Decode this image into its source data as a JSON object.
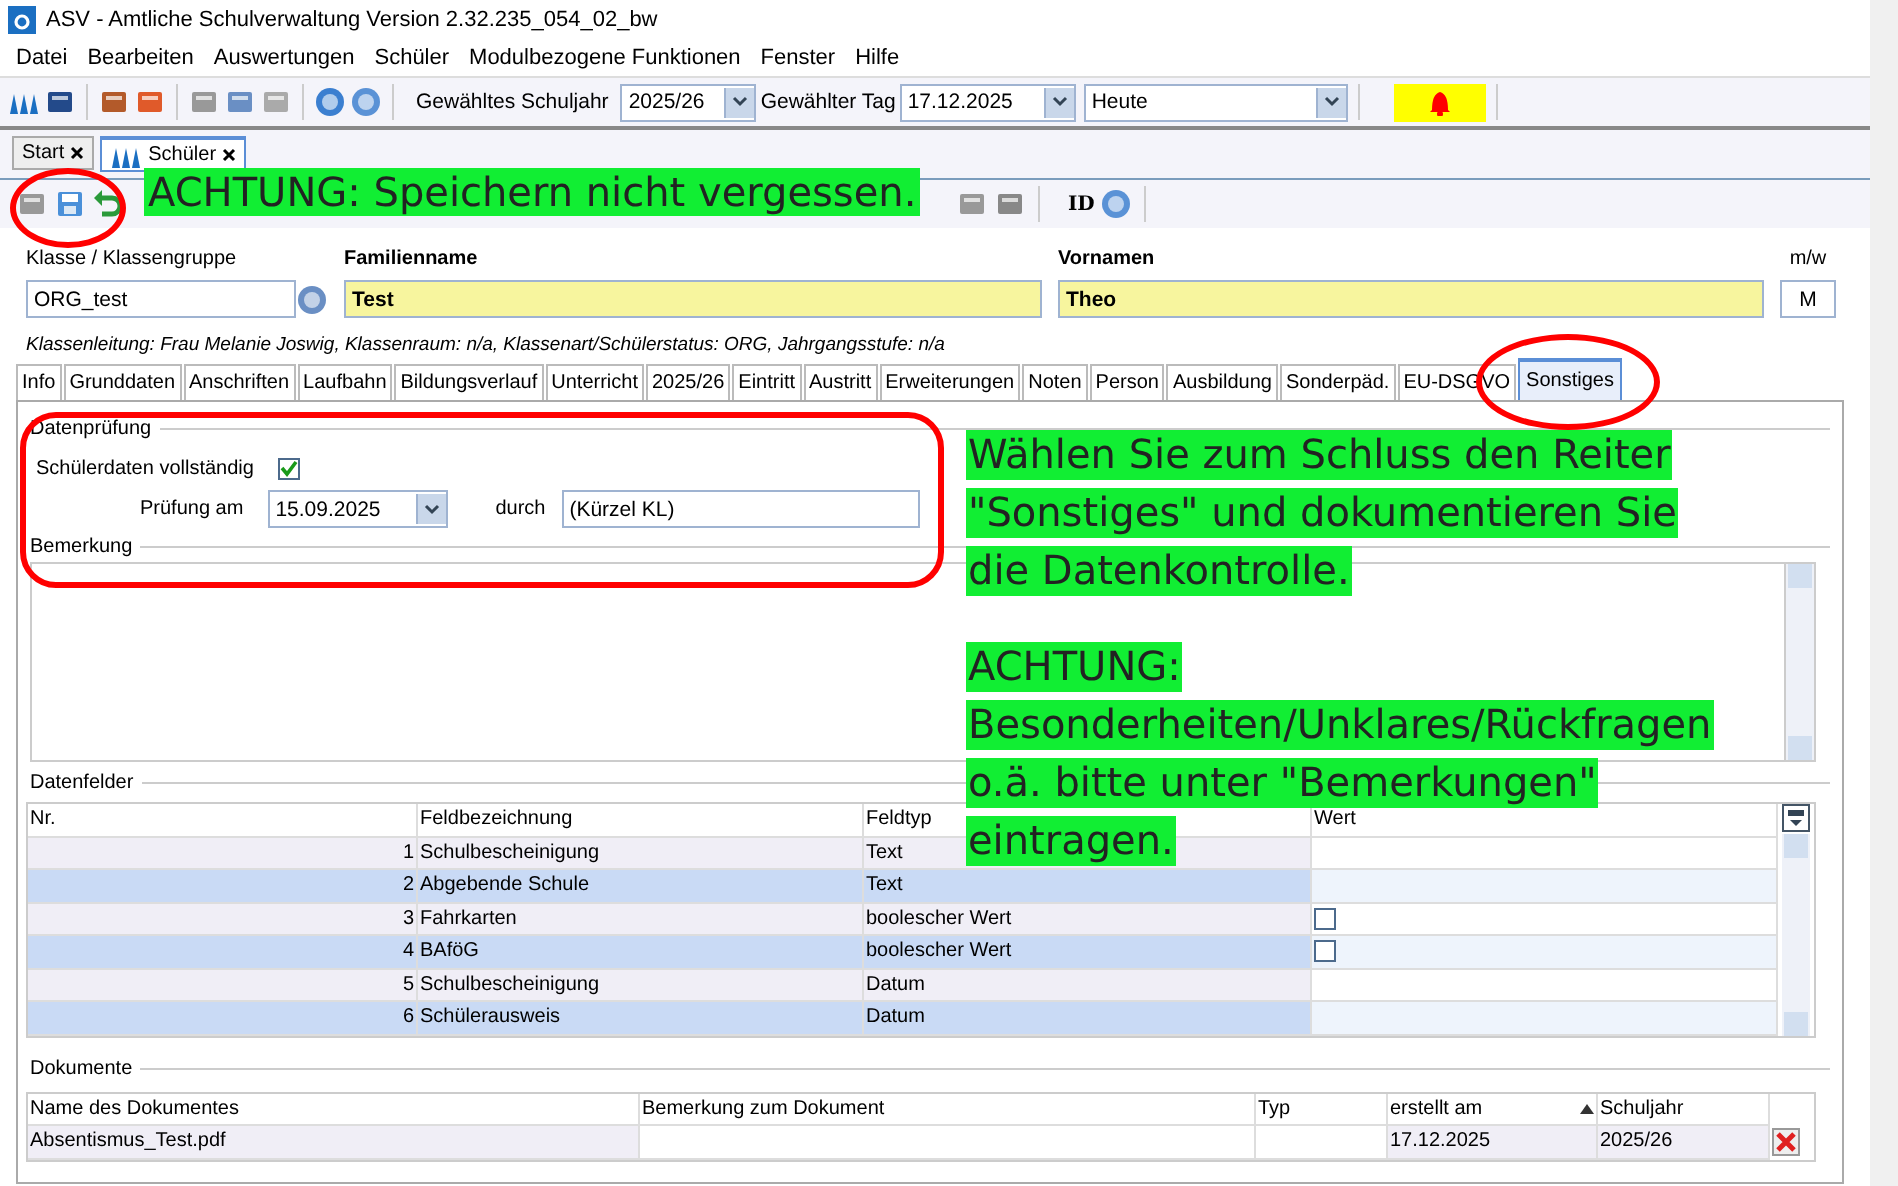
{
  "window": {
    "title": "ASV - Amtliche Schulverwaltung Version 2.32.235_054_02_bw"
  },
  "menu": [
    {
      "label": "Datei"
    },
    {
      "label": "Bearbeiten"
    },
    {
      "label": "Auswertungen"
    },
    {
      "label": "Schüler"
    },
    {
      "label": "Modulbezogene Funktionen"
    },
    {
      "label": "Fenster"
    },
    {
      "label": "Hilfe"
    }
  ],
  "toolbar": {
    "schuljahr_label": "Gewähltes Schuljahr",
    "schuljahr": "2025/26",
    "tag_label": "Gewählter Tag",
    "tag": "17.12.2025",
    "tag_mode": "Heute"
  },
  "doc_tabs": [
    {
      "label": "Start",
      "selected": false
    },
    {
      "label": "Schüler",
      "selected": true
    }
  ],
  "toolbar2": {
    "id_label": "ID"
  },
  "callout_top": "ACHTUNG: Speichern nicht vergessen.",
  "student": {
    "klasse_label": "Klasse / Klassengruppe",
    "klasse": "ORG_test",
    "familienname_label": "Familienname",
    "familienname": "Test",
    "vornamen_label": "Vornamen",
    "vornamen": "Theo",
    "gender_label": "m/w",
    "gender": "M",
    "info": "Klassenleitung: Frau Melanie Joswig, Klassenraum: n/a, Klassenart/Schülerstatus: ORG, Jahrgangsstufe: n/a"
  },
  "tabs": [
    {
      "label": "Info",
      "selected": false
    },
    {
      "label": "Grunddaten",
      "selected": false
    },
    {
      "label": "Anschriften",
      "selected": false
    },
    {
      "label": "Laufbahn",
      "selected": false
    },
    {
      "label": "Bildungsverlauf",
      "selected": false
    },
    {
      "label": "Unterricht",
      "selected": false
    },
    {
      "label": "2025/26",
      "selected": false
    },
    {
      "label": "Eintritt",
      "selected": false
    },
    {
      "label": "Austritt",
      "selected": false
    },
    {
      "label": "Erweiterungen",
      "selected": false
    },
    {
      "label": "Noten",
      "selected": false
    },
    {
      "label": "Person",
      "selected": false
    },
    {
      "label": "Ausbildung",
      "selected": false
    },
    {
      "label": "Sonderpäd.",
      "selected": false
    },
    {
      "label": "EU-DSGVO",
      "selected": false
    },
    {
      "label": "Sonstiges",
      "selected": true
    }
  ],
  "datenpruefung": {
    "title": "Datenprüfung",
    "complete_label": "Schülerdaten vollständig",
    "complete": true,
    "date_label": "Prüfung am",
    "date": "15.09.2025",
    "by_label": "durch",
    "by": "(Kürzel KL)"
  },
  "bemerkung": {
    "title": "Bemerkung"
  },
  "callout_right": [
    [
      "Wählen Sie zum Schluss den Reiter",
      "\"Sonstiges\" und dokumentieren Sie",
      "die Datenkontrolle."
    ],
    [
      "ACHTUNG:",
      "Besonderheiten/Unklares/Rückfragen",
      "o.ä. bitte unter \"Bemerkungen\"",
      "eintragen."
    ]
  ],
  "datenfelder": {
    "title": "Datenfelder",
    "columns": [
      "Nr.",
      "Feldbezeichnung",
      "Feldtyp",
      "Wert"
    ],
    "rows": [
      {
        "nr": "1",
        "name": "Schulbescheinigung",
        "type": "Text",
        "kind": "text"
      },
      {
        "nr": "2",
        "name": "Abgebende Schule",
        "type": "Text",
        "kind": "text"
      },
      {
        "nr": "3",
        "name": "Fahrkarten",
        "type": "boolescher Wert",
        "kind": "checkbox",
        "checked": false
      },
      {
        "nr": "4",
        "name": "BAföG",
        "type": "boolescher Wert",
        "kind": "checkbox",
        "checked": false
      },
      {
        "nr": "5",
        "name": "Schulbescheinigung",
        "type": "Datum",
        "kind": "text"
      },
      {
        "nr": "6",
        "name": "Schülerausweis",
        "type": "Datum",
        "kind": "text"
      }
    ]
  },
  "dokumente": {
    "title": "Dokumente",
    "columns": [
      "Name des Dokumentes",
      "Bemerkung zum Dokument",
      "Typ",
      "erstellt am",
      "Schuljahr"
    ],
    "rows": [
      {
        "name": "Absentismus_Test.pdf",
        "date": "17.12.2025",
        "year": "2025/26"
      }
    ]
  }
}
